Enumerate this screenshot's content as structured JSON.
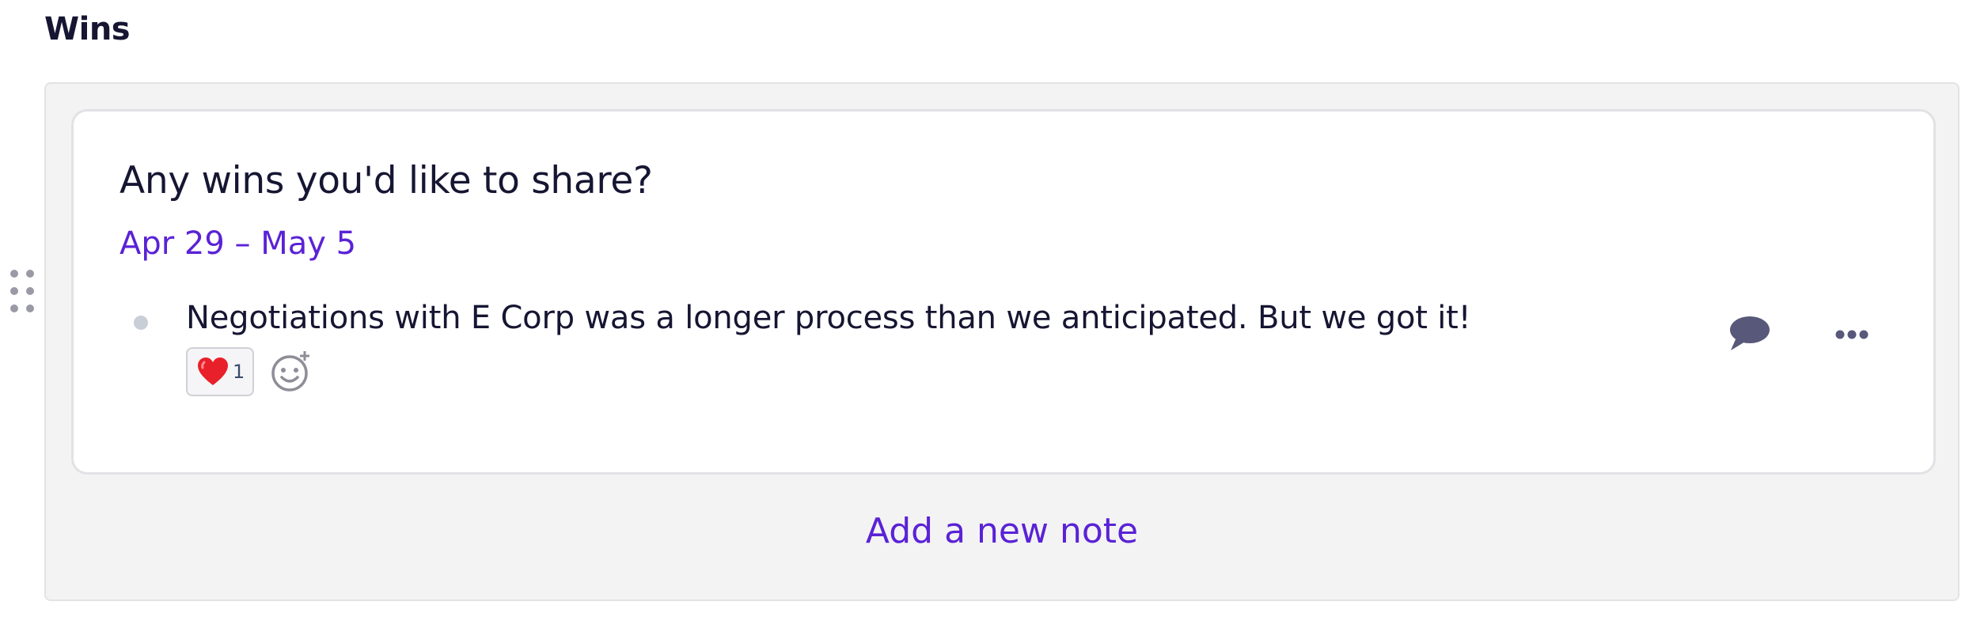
{
  "section": {
    "title": "Wins"
  },
  "card": {
    "question": "Any wins you'd like to share?",
    "date_range": "Apr 29 – May 5",
    "notes": [
      {
        "text": "Negotiations with E Corp was a longer process than we anticipated. But we got it!",
        "reactions": [
          {
            "emoji": "heart-emoji",
            "count": "1"
          }
        ]
      }
    ]
  },
  "actions": {
    "add_note_label": "Add a new note"
  },
  "colors": {
    "accent": "#5a22d6",
    "text": "#161633",
    "panel_bg": "#f3f3f3",
    "heart": "#e8202a"
  },
  "icons": {
    "drag": "drag-handle-icon",
    "bullet": "bullet-icon",
    "add_reaction": "add-reaction-icon",
    "comment": "comment-icon",
    "more": "more-options-icon"
  }
}
